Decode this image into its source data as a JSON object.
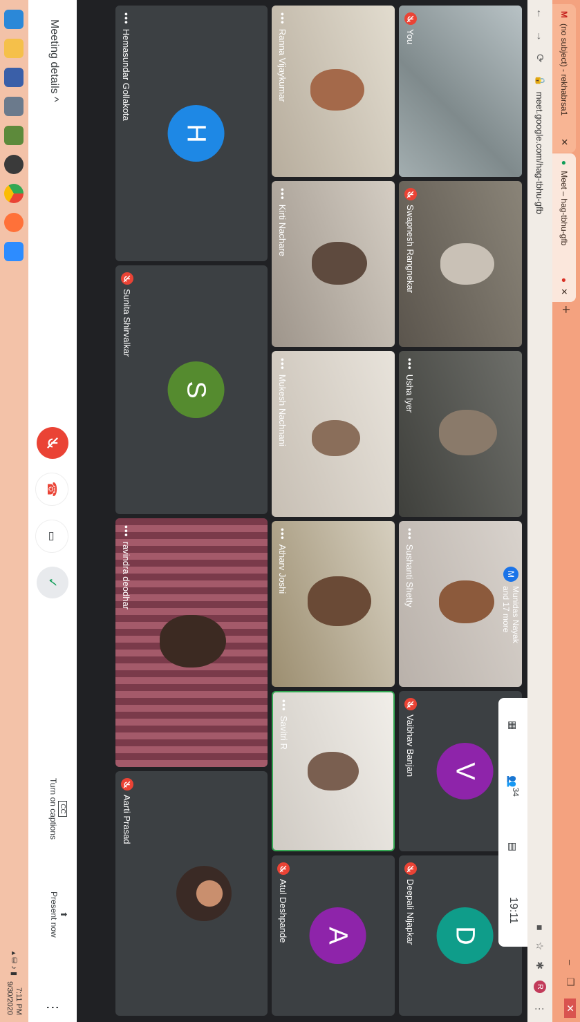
{
  "browser": {
    "tabs": [
      {
        "label": "(no subject) - rekhabrsa1"
      },
      {
        "label": "Meet – hag-tbhu-gfb"
      }
    ],
    "url": "meet.google.com/hag-tbhu-gfb"
  },
  "meet": {
    "people_chip": {
      "initial": "M",
      "line1": "Munidas Nayak",
      "line2": "and 17 more"
    },
    "top_panel": {
      "people_count": "34",
      "time": "19:11",
      "you_label": "You"
    },
    "tiles": [
      {
        "name": "You"
      },
      {
        "name": "Swapnesh Rangnekar"
      },
      {
        "name": "Usha Iyer"
      },
      {
        "name": "Sushanti Shetty"
      },
      {
        "name": "Vaibhav Banjan",
        "initial": "V",
        "color": "#8e24aa"
      },
      {
        "name": "Deepali Nijapkar",
        "initial": "D",
        "color": "#0f9d8a"
      },
      {
        "name": "Ranna Vijaykumar"
      },
      {
        "name": "Kirti Nachare"
      },
      {
        "name": "Mukesh Nachnani"
      },
      {
        "name": "Atharv Joshi"
      },
      {
        "name": "Savitri R"
      },
      {
        "name": "Atul Deshpande",
        "initial": "A",
        "color": "#8e24aa"
      },
      {
        "name": "Hemasundar Gollakota",
        "initial": "H",
        "color": "#1e88e5"
      },
      {
        "name": "Sunita Shirvalkar",
        "initial": "S",
        "color": "#558b2f"
      },
      {
        "name": "ravindra deodhar"
      },
      {
        "name": "Aarti Prasad"
      }
    ]
  },
  "bottombar": {
    "meeting_details": "Meeting details",
    "captions": "Turn on captions",
    "captions_icon": "CC",
    "present": "Present now"
  },
  "taskbar": {
    "time": "7:11 PM",
    "date": "9/30/2020"
  }
}
